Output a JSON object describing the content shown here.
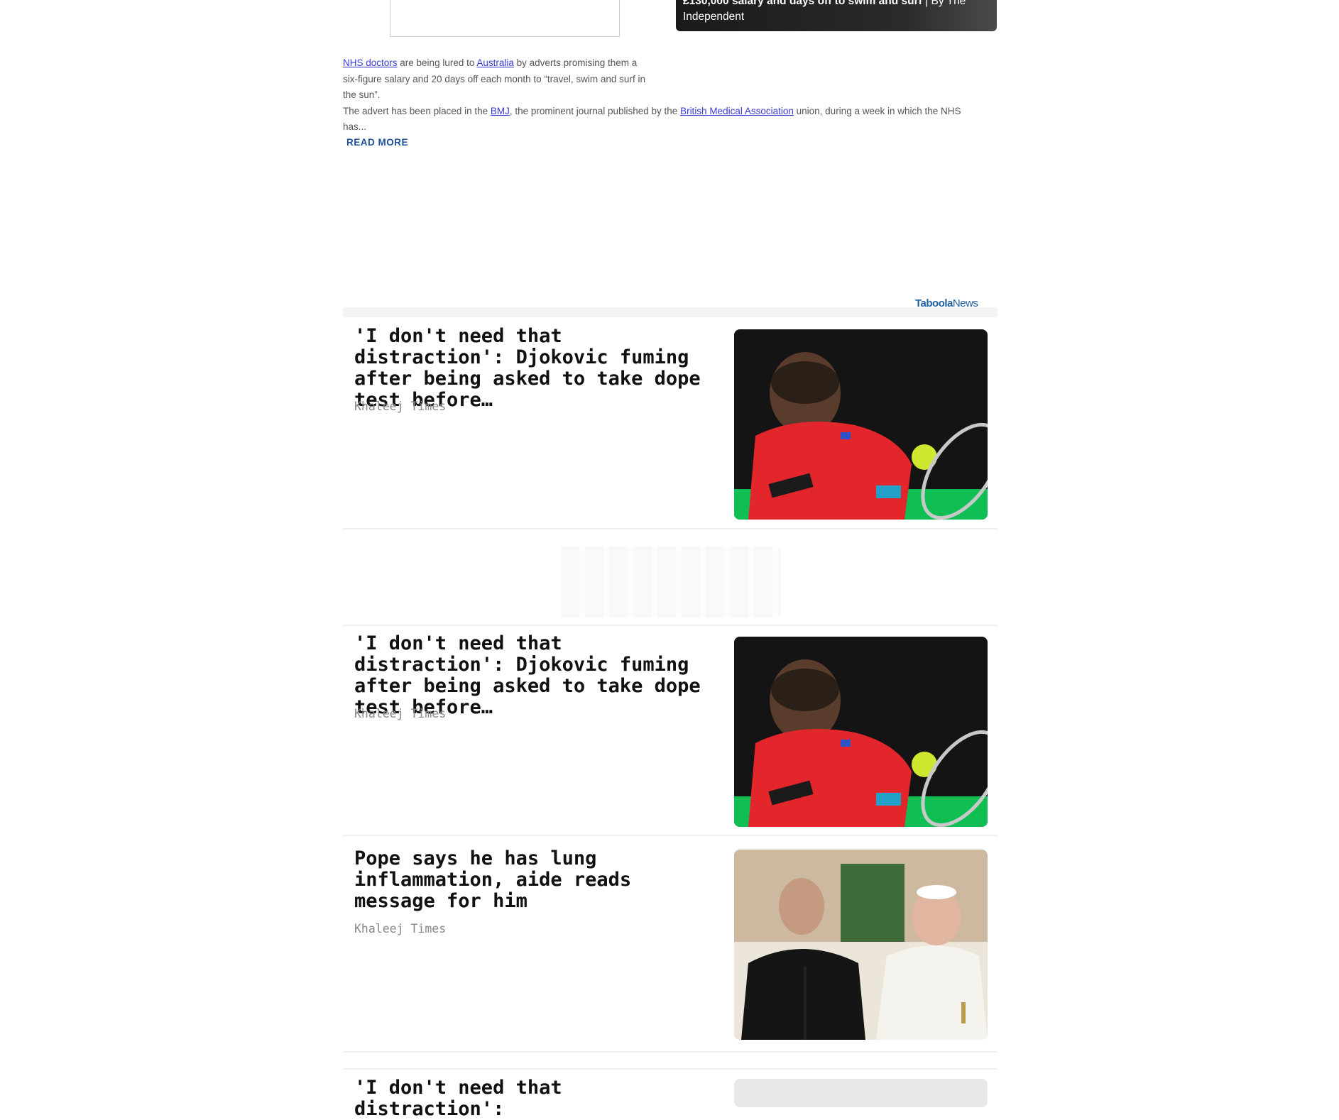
{
  "top_teaser": {
    "headline_bold": "£130,000 salary and days off to swim and surf",
    "byline": " | By The Independent"
  },
  "article": {
    "link_nhs": "NHS doctors",
    "t1": " are being lured to ",
    "link_australia": "Australia",
    "t2": " by adverts promising them a six-figure salary and 20 days off each month to “travel, swim and surf in the sun”.",
    "t3": "The advert has been placed in the ",
    "link_bmj": "BMJ",
    "t4": ", the prominent journal published by the ",
    "link_bma": "British Medical Association",
    "t5": " union, during a week in which the NHS has...",
    "read_more": "READ MORE"
  },
  "taboola": {
    "brand": "Taboola",
    "suffix": "News"
  },
  "feed": [
    {
      "title": "'I don't need that distraction': Djokovic fuming after being asked to take dope test before…",
      "source": "Khaleej Times",
      "image": "djokovic-tennis-photo"
    },
    {
      "title": "'I don't need that distraction': Djokovic fuming after being asked to take dope test before…",
      "source": "Khaleej Times",
      "image": "djokovic-tennis-photo"
    },
    {
      "title": "Pope says he has lung inflammation, aide reads message for him",
      "source": "Khaleej Times",
      "image": "pope-aide-photo"
    },
    {
      "title": "'I don't need that distraction':",
      "source": "",
      "image": "partial-photo"
    }
  ]
}
